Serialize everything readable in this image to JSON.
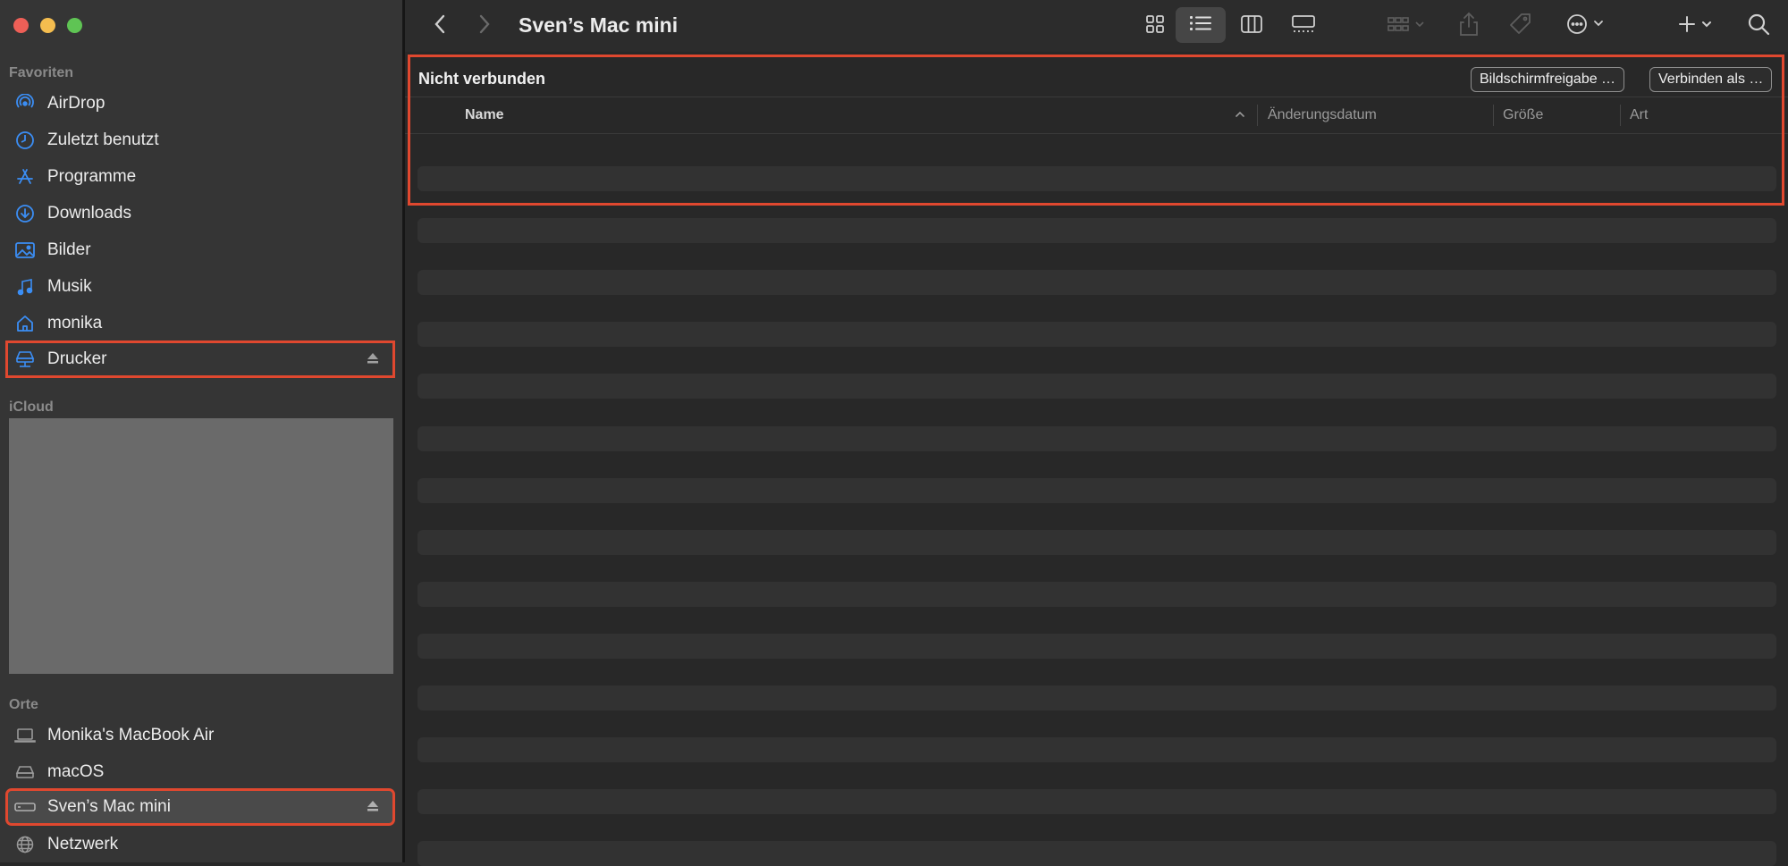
{
  "window": {
    "title": "Sven’s Mac mini"
  },
  "sidebar": {
    "favorites_title": "Favoriten",
    "favorites": [
      {
        "label": "AirDrop",
        "icon": "airdrop-icon"
      },
      {
        "label": "Zuletzt benutzt",
        "icon": "clock-icon"
      },
      {
        "label": "Programme",
        "icon": "applications-icon"
      },
      {
        "label": "Downloads",
        "icon": "download-icon"
      },
      {
        "label": "Bilder",
        "icon": "photo-icon"
      },
      {
        "label": "Musik",
        "icon": "music-note-icon"
      },
      {
        "label": "monika",
        "icon": "home-icon"
      },
      {
        "label": "Drucker",
        "icon": "network-drive-icon",
        "eject": true
      }
    ],
    "icloud_title": "iCloud",
    "locations_title": "Orte",
    "locations": [
      {
        "label": "Monika's MacBook Air",
        "icon": "laptop-icon"
      },
      {
        "label": "macOS",
        "icon": "internal-disk-icon"
      },
      {
        "label": "Sven’s Mac mini",
        "icon": "mac-mini-icon",
        "eject": true,
        "selected": true
      },
      {
        "label": "Netzwerk",
        "icon": "globe-icon"
      }
    ]
  },
  "content": {
    "status_title": "Nicht verbunden",
    "screen_share_button": "Bildschirmfreigabe …",
    "connect_as_button": "Verbinden als …",
    "columns": [
      "Name",
      "Änderungsdatum",
      "Größe",
      "Art"
    ]
  },
  "colors": {
    "accent_blue": "#3b8ef5",
    "highlight_red": "#e0482f",
    "sidebar_bg": "#353535",
    "content_bg": "#282828"
  }
}
